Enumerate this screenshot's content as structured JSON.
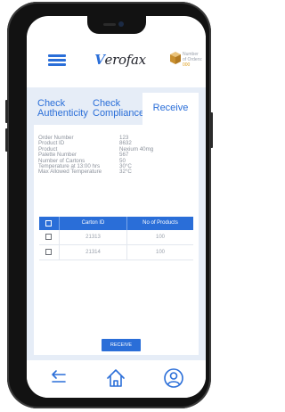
{
  "header": {
    "logo_text": "erofax",
    "logo_initial": "V",
    "orders_label_line1": "Number",
    "orders_label_line2": "of Orders:",
    "orders_count": "000"
  },
  "tabs": [
    {
      "line1": "Check",
      "line2": "Authenticity",
      "active": false
    },
    {
      "line1": "Check",
      "line2": "Compliance",
      "active": false
    },
    {
      "label": "Receive",
      "active": true
    }
  ],
  "info": [
    {
      "key": "Order Number",
      "value": "123"
    },
    {
      "key": "Product ID",
      "value": "8632"
    },
    {
      "key": "Product",
      "value": "Nexium 40mg"
    },
    {
      "key": "Palette Number",
      "value": "567"
    },
    {
      "key": "Number of Cartons",
      "value": "50"
    },
    {
      "key": "Temperature at 13:00 hrs",
      "value": "30°C"
    },
    {
      "key": "Max Allowed Temperature",
      "value": "32°C"
    }
  ],
  "table": {
    "columns": [
      "Carton ID",
      "No of Products"
    ],
    "rows": [
      {
        "carton_id": "21313",
        "products": "100"
      },
      {
        "carton_id": "21314",
        "products": "100"
      }
    ]
  },
  "receive_button": "RECEIVE",
  "colors": {
    "accent": "#2a6ed8",
    "background": "#e6edf7",
    "badge": "#e0a020"
  },
  "icons": {
    "menu": "hamburger-icon",
    "box": "box-icon",
    "back": "back-arrow-icon",
    "home": "home-icon",
    "profile": "profile-icon"
  }
}
